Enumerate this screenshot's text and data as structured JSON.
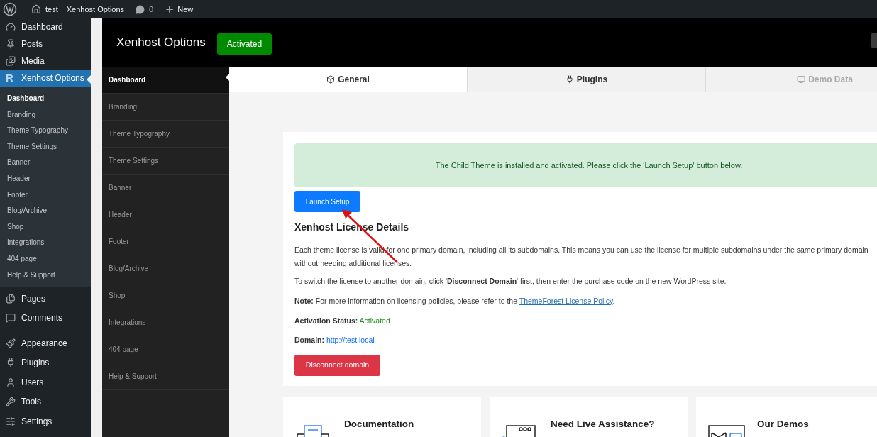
{
  "admin_bar": {
    "site": "test",
    "plugin": "Xenhost Options",
    "comments": "0",
    "new": "New"
  },
  "wp_menu": {
    "top": [
      {
        "label": "Dashboard",
        "selected": false
      },
      {
        "label": "Posts",
        "selected": false
      },
      {
        "label": "Media",
        "selected": false
      },
      {
        "label": "Xenhost Options",
        "selected": true,
        "icon_text": "R"
      }
    ],
    "submenu": [
      {
        "label": "Dashboard",
        "selected": true
      },
      {
        "label": "Branding",
        "selected": false
      },
      {
        "label": "Theme Typography",
        "selected": false
      },
      {
        "label": "Theme Settings",
        "selected": false
      },
      {
        "label": "Banner",
        "selected": false
      },
      {
        "label": "Header",
        "selected": false
      },
      {
        "label": "Footer",
        "selected": false
      },
      {
        "label": "Blog/Archive",
        "selected": false
      },
      {
        "label": "Shop",
        "selected": false
      },
      {
        "label": "Integrations",
        "selected": false
      },
      {
        "label": "404 page",
        "selected": false
      },
      {
        "label": "Help & Support",
        "selected": false
      }
    ],
    "bottom": [
      {
        "label": "Pages",
        "selected": false
      },
      {
        "label": "Comments",
        "selected": false
      },
      {
        "label": "Appearance",
        "selected": false
      },
      {
        "label": "Plugins",
        "selected": false
      },
      {
        "label": "Users",
        "selected": false
      },
      {
        "label": "Tools",
        "selected": false
      },
      {
        "label": "Settings",
        "selected": false
      }
    ]
  },
  "panel": {
    "title": "Xenhost Options",
    "status_badge": "Activated"
  },
  "nav": [
    {
      "label": "Dashboard",
      "selected": true
    },
    {
      "label": "Branding",
      "selected": false
    },
    {
      "label": "Theme Typography",
      "selected": false
    },
    {
      "label": "Theme Settings",
      "selected": false
    },
    {
      "label": "Banner",
      "selected": false
    },
    {
      "label": "Header",
      "selected": false
    },
    {
      "label": "Footer",
      "selected": false
    },
    {
      "label": "Blog/Archive",
      "selected": false
    },
    {
      "label": "Shop",
      "selected": false
    },
    {
      "label": "Integrations",
      "selected": false
    },
    {
      "label": "404 page",
      "selected": false
    },
    {
      "label": "Help & Support",
      "selected": false
    }
  ],
  "tabs": [
    {
      "label": "General",
      "selected": true,
      "disabled": false
    },
    {
      "label": "Plugins",
      "selected": false,
      "disabled": false
    },
    {
      "label": "Demo Data",
      "selected": false,
      "disabled": true
    }
  ],
  "license": {
    "alert": "The Child Theme is installed and activated. Please click the 'Launch Setup' button below.",
    "launch_button": "Launch Setup",
    "heading": "Xenhost License Details",
    "paragraph": "Each theme license is valid for one primary domain, including all its subdomains. This means you can use the license for multiple subdomains under the same primary domain without needing additional licenses.",
    "switch_text": "To switch the license to another domain, click '**Disconnect Domain**' first, then enter the purchase code on the new WordPress site.",
    "note": {
      "before": "**Note:** For more information on licensing policies, please refer to the",
      "link": "ThemeForest License Policy",
      "after": "."
    },
    "status_label": "Activation Status:",
    "status_value": "Activated",
    "domain_label": "Domain:",
    "domain_value": "http://test.local",
    "disconnect_button": "Disconnect domain"
  },
  "cards": [
    {
      "title": "Documentation"
    },
    {
      "title": "Need Live Assistance?"
    },
    {
      "title": "Our Demos"
    }
  ]
}
